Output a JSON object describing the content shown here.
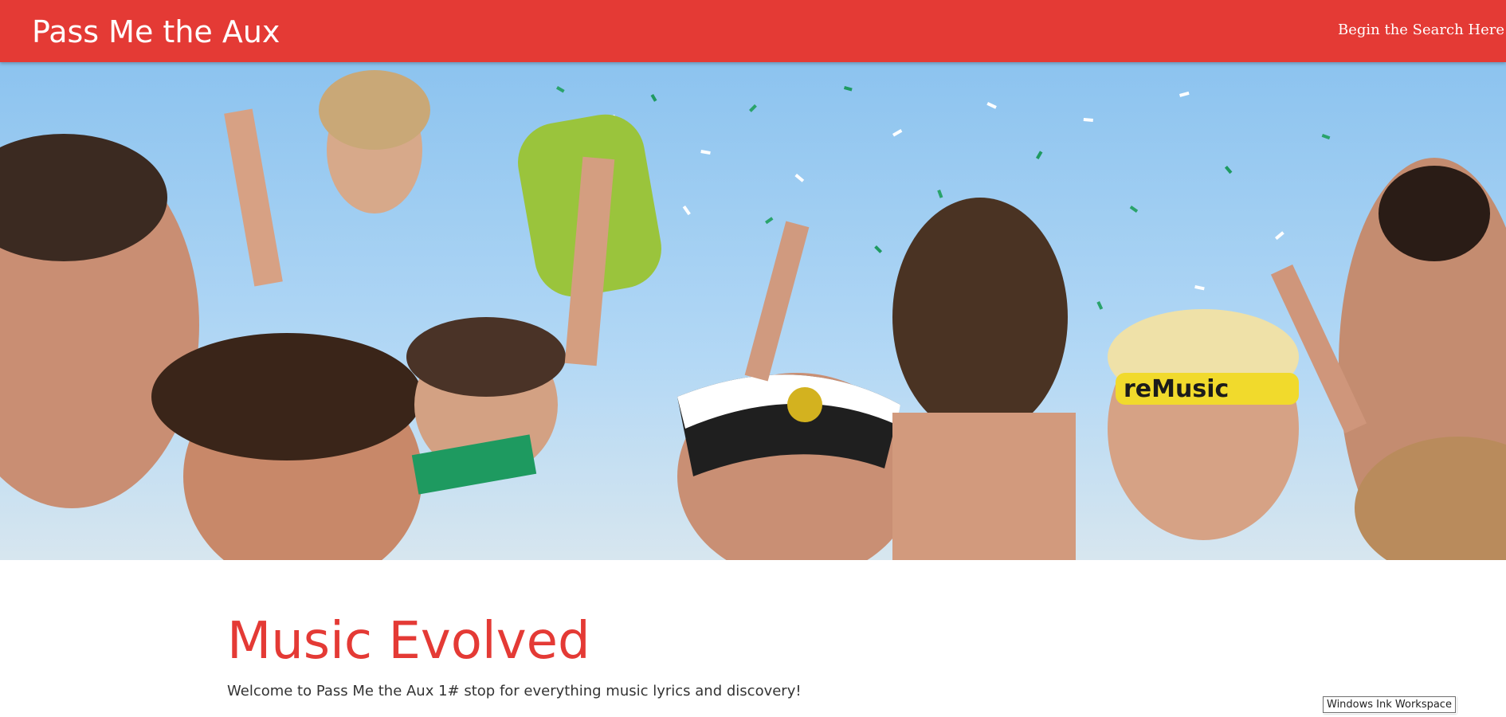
{
  "header": {
    "brand": "Pass Me the Aux",
    "nav_link": "Begin the Search Here"
  },
  "hero": {
    "image": "concert-crowd-confetti-photo",
    "visible_text": "reMusic"
  },
  "main": {
    "headline": "Music Evolved",
    "welcome": "Welcome to Pass Me the Aux 1# stop for everything music lyrics and discovery!"
  },
  "tooltip": {
    "text": "Windows Ink Workspace"
  },
  "colors": {
    "brand_red": "#e43a35",
    "sky": "#8dc4ee",
    "body_text": "#333333"
  }
}
